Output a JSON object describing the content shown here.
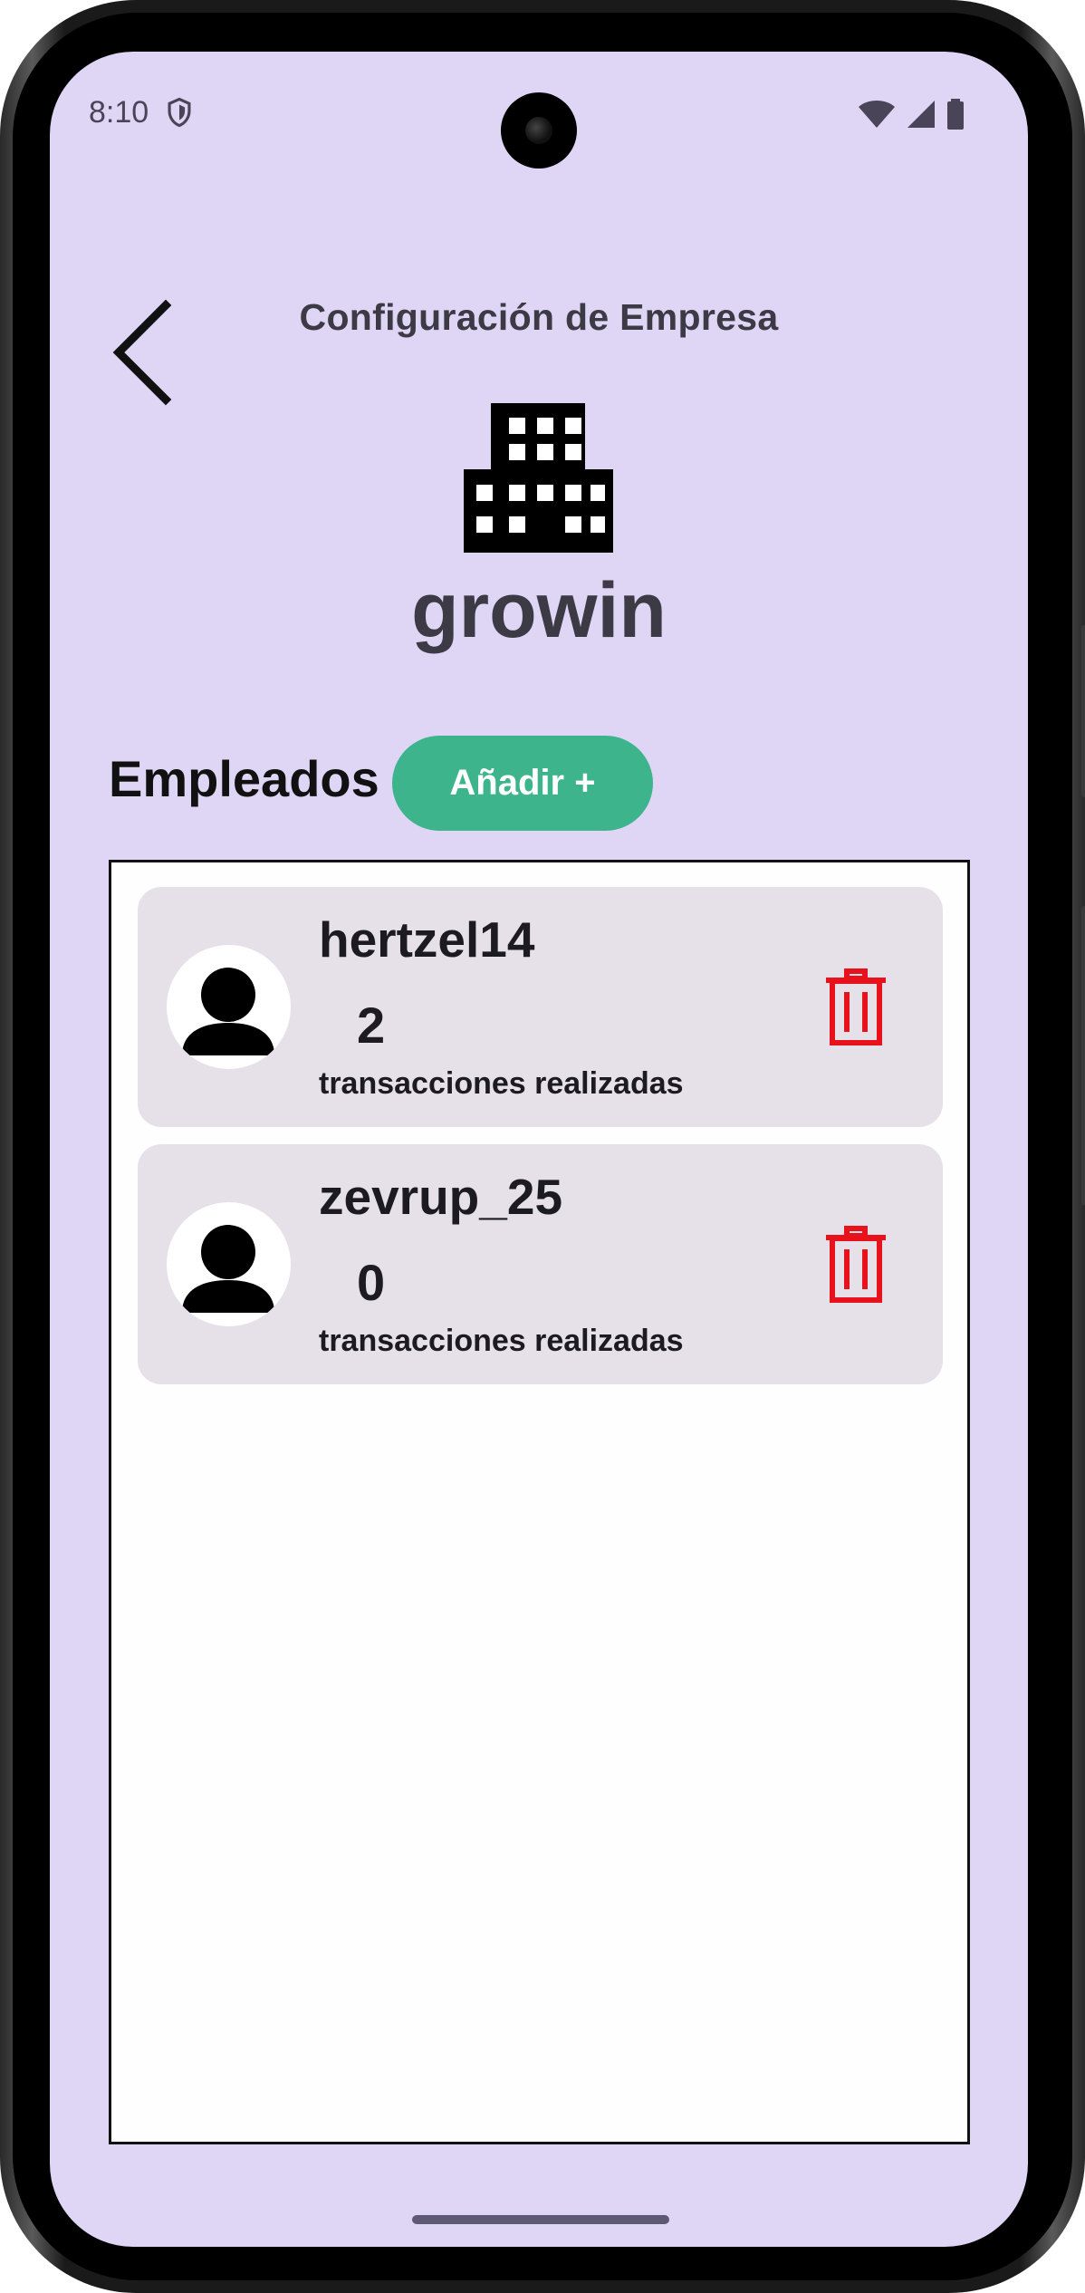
{
  "status_bar": {
    "time": "8:10",
    "icons": [
      "shield-icon",
      "wifi-icon",
      "signal-icon",
      "battery-icon"
    ]
  },
  "header": {
    "title": "Configuración de Empresa",
    "back_icon": "chevron-left-icon"
  },
  "company": {
    "name": "growin",
    "icon": "building-icon"
  },
  "employees_section": {
    "heading": "Empleados",
    "add_label": "Añadir +"
  },
  "employees": [
    {
      "username": "hertzel14",
      "transactions": "2",
      "transactions_label": "transacciones realizadas"
    },
    {
      "username": "zevrup_25",
      "transactions": "0",
      "transactions_label": "transacciones realizadas"
    }
  ],
  "colors": {
    "background": "#dfd6f6",
    "accent": "#3db48b",
    "card": "#e6e0e8",
    "delete": "#e8121c"
  }
}
